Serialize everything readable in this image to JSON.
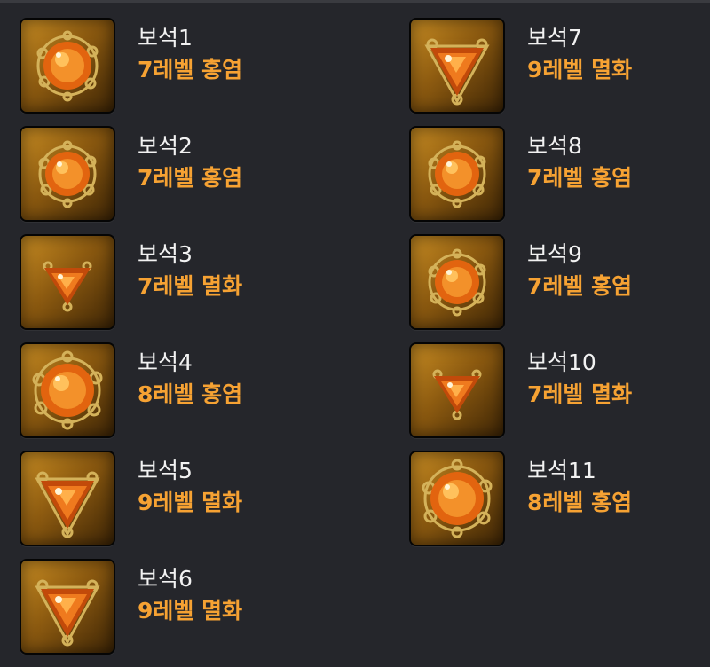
{
  "colors": {
    "background": "#25262b",
    "name_text": "#f2f2f2",
    "desc_text": "#f6a233",
    "slot_gold": "#c98d23"
  },
  "left_items": [
    {
      "name": "보석1",
      "desc": "7레벨 홍염",
      "icon": "flame-gem-round-icon"
    },
    {
      "name": "보석2",
      "desc": "7레벨 홍염",
      "icon": "flame-gem-round-icon"
    },
    {
      "name": "보석3",
      "desc": "7레벨 멸화",
      "icon": "destruction-gem-triangle-icon"
    },
    {
      "name": "보석4",
      "desc": "8레벨 홍염",
      "icon": "flame-gem-round-icon"
    },
    {
      "name": "보석5",
      "desc": "9레벨 멸화",
      "icon": "destruction-gem-triangle-icon"
    },
    {
      "name": "보석6",
      "desc": "9레벨 멸화",
      "icon": "destruction-gem-triangle-icon"
    }
  ],
  "right_items": [
    {
      "name": "보석7",
      "desc": "9레벨 멸화",
      "icon": "destruction-gem-triangle-icon"
    },
    {
      "name": "보석8",
      "desc": "7레벨 홍염",
      "icon": "flame-gem-round-icon"
    },
    {
      "name": "보석9",
      "desc": "7레벨 홍염",
      "icon": "flame-gem-round-icon"
    },
    {
      "name": "보석10",
      "desc": "7레벨 멸화",
      "icon": "destruction-gem-triangle-icon"
    },
    {
      "name": "보석11",
      "desc": "8레벨 홍염",
      "icon": "flame-gem-round-icon"
    }
  ]
}
